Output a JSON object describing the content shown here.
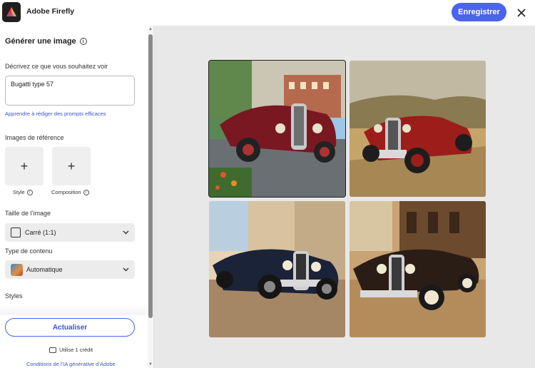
{
  "header": {
    "app_title": "Adobe Firefly",
    "register_label": "Enregistrer",
    "logo_icon": "adobe-firefly-logo",
    "close_icon": "close-icon"
  },
  "panel": {
    "title": "Générer une image",
    "prompt_label": "Décrivez ce que vous souhaitez voir",
    "prompt_value": "Bugatti type 57",
    "prompt_link": "Apprendre à rédiger des prompts efficaces",
    "reference_label": "Images de référence",
    "reference_items": [
      {
        "label": "Style"
      },
      {
        "label": "Composition"
      }
    ],
    "size_label": "Taille de l’image",
    "size_value": "Carré (1:1)",
    "content_type_label": "Type de contenu",
    "content_type_value": "Automatique",
    "styles_label": "Styles",
    "update_label": "Actualiser",
    "credit_text": "Utilise 1 crédit",
    "terms_link": "Conditions de l’IA générative d’Adobe"
  },
  "results": {
    "images": [
      {
        "name": "generated-image-1",
        "selected": true
      },
      {
        "name": "generated-image-2",
        "selected": false
      },
      {
        "name": "generated-image-3",
        "selected": false
      },
      {
        "name": "generated-image-4",
        "selected": false
      }
    ]
  },
  "colors": {
    "accent": "#4b64e8",
    "link": "#3a53d6",
    "canvas_bg": "#e8e8e8"
  }
}
